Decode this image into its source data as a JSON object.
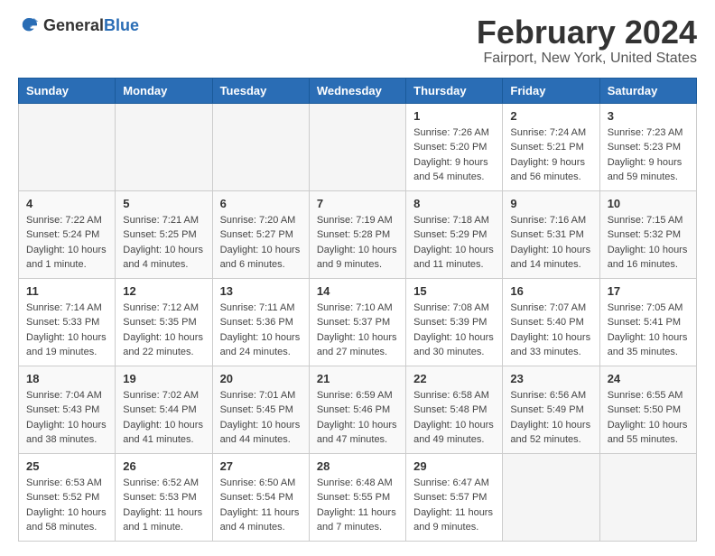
{
  "header": {
    "logo_general": "General",
    "logo_blue": "Blue",
    "title": "February 2024",
    "subtitle": "Fairport, New York, United States"
  },
  "days_of_week": [
    "Sunday",
    "Monday",
    "Tuesday",
    "Wednesday",
    "Thursday",
    "Friday",
    "Saturday"
  ],
  "weeks": [
    [
      {
        "day": "",
        "info": ""
      },
      {
        "day": "",
        "info": ""
      },
      {
        "day": "",
        "info": ""
      },
      {
        "day": "",
        "info": ""
      },
      {
        "day": "1",
        "info": "Sunrise: 7:26 AM\nSunset: 5:20 PM\nDaylight: 9 hours\nand 54 minutes."
      },
      {
        "day": "2",
        "info": "Sunrise: 7:24 AM\nSunset: 5:21 PM\nDaylight: 9 hours\nand 56 minutes."
      },
      {
        "day": "3",
        "info": "Sunrise: 7:23 AM\nSunset: 5:23 PM\nDaylight: 9 hours\nand 59 minutes."
      }
    ],
    [
      {
        "day": "4",
        "info": "Sunrise: 7:22 AM\nSunset: 5:24 PM\nDaylight: 10 hours\nand 1 minute."
      },
      {
        "day": "5",
        "info": "Sunrise: 7:21 AM\nSunset: 5:25 PM\nDaylight: 10 hours\nand 4 minutes."
      },
      {
        "day": "6",
        "info": "Sunrise: 7:20 AM\nSunset: 5:27 PM\nDaylight: 10 hours\nand 6 minutes."
      },
      {
        "day": "7",
        "info": "Sunrise: 7:19 AM\nSunset: 5:28 PM\nDaylight: 10 hours\nand 9 minutes."
      },
      {
        "day": "8",
        "info": "Sunrise: 7:18 AM\nSunset: 5:29 PM\nDaylight: 10 hours\nand 11 minutes."
      },
      {
        "day": "9",
        "info": "Sunrise: 7:16 AM\nSunset: 5:31 PM\nDaylight: 10 hours\nand 14 minutes."
      },
      {
        "day": "10",
        "info": "Sunrise: 7:15 AM\nSunset: 5:32 PM\nDaylight: 10 hours\nand 16 minutes."
      }
    ],
    [
      {
        "day": "11",
        "info": "Sunrise: 7:14 AM\nSunset: 5:33 PM\nDaylight: 10 hours\nand 19 minutes."
      },
      {
        "day": "12",
        "info": "Sunrise: 7:12 AM\nSunset: 5:35 PM\nDaylight: 10 hours\nand 22 minutes."
      },
      {
        "day": "13",
        "info": "Sunrise: 7:11 AM\nSunset: 5:36 PM\nDaylight: 10 hours\nand 24 minutes."
      },
      {
        "day": "14",
        "info": "Sunrise: 7:10 AM\nSunset: 5:37 PM\nDaylight: 10 hours\nand 27 minutes."
      },
      {
        "day": "15",
        "info": "Sunrise: 7:08 AM\nSunset: 5:39 PM\nDaylight: 10 hours\nand 30 minutes."
      },
      {
        "day": "16",
        "info": "Sunrise: 7:07 AM\nSunset: 5:40 PM\nDaylight: 10 hours\nand 33 minutes."
      },
      {
        "day": "17",
        "info": "Sunrise: 7:05 AM\nSunset: 5:41 PM\nDaylight: 10 hours\nand 35 minutes."
      }
    ],
    [
      {
        "day": "18",
        "info": "Sunrise: 7:04 AM\nSunset: 5:43 PM\nDaylight: 10 hours\nand 38 minutes."
      },
      {
        "day": "19",
        "info": "Sunrise: 7:02 AM\nSunset: 5:44 PM\nDaylight: 10 hours\nand 41 minutes."
      },
      {
        "day": "20",
        "info": "Sunrise: 7:01 AM\nSunset: 5:45 PM\nDaylight: 10 hours\nand 44 minutes."
      },
      {
        "day": "21",
        "info": "Sunrise: 6:59 AM\nSunset: 5:46 PM\nDaylight: 10 hours\nand 47 minutes."
      },
      {
        "day": "22",
        "info": "Sunrise: 6:58 AM\nSunset: 5:48 PM\nDaylight: 10 hours\nand 49 minutes."
      },
      {
        "day": "23",
        "info": "Sunrise: 6:56 AM\nSunset: 5:49 PM\nDaylight: 10 hours\nand 52 minutes."
      },
      {
        "day": "24",
        "info": "Sunrise: 6:55 AM\nSunset: 5:50 PM\nDaylight: 10 hours\nand 55 minutes."
      }
    ],
    [
      {
        "day": "25",
        "info": "Sunrise: 6:53 AM\nSunset: 5:52 PM\nDaylight: 10 hours\nand 58 minutes."
      },
      {
        "day": "26",
        "info": "Sunrise: 6:52 AM\nSunset: 5:53 PM\nDaylight: 11 hours\nand 1 minute."
      },
      {
        "day": "27",
        "info": "Sunrise: 6:50 AM\nSunset: 5:54 PM\nDaylight: 11 hours\nand 4 minutes."
      },
      {
        "day": "28",
        "info": "Sunrise: 6:48 AM\nSunset: 5:55 PM\nDaylight: 11 hours\nand 7 minutes."
      },
      {
        "day": "29",
        "info": "Sunrise: 6:47 AM\nSunset: 5:57 PM\nDaylight: 11 hours\nand 9 minutes."
      },
      {
        "day": "",
        "info": ""
      },
      {
        "day": "",
        "info": ""
      }
    ]
  ]
}
